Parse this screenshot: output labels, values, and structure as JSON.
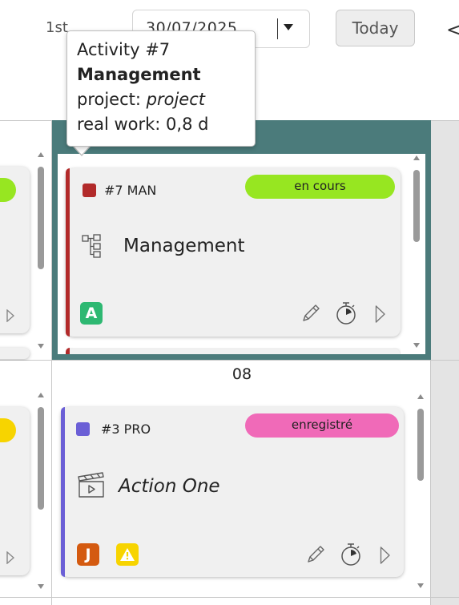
{
  "toolbar": {
    "prefix_label": "1st",
    "date_value": "30/07/2025",
    "today_label": "Today",
    "prev_icon": "chevron-left-icon"
  },
  "calendar": {
    "today_day_label": "",
    "next_day_label": "08",
    "today_header_color": "#4b7b7b"
  },
  "cards": [
    {
      "ref": "#7 MAN",
      "type_color": "#b22a2a",
      "status": "en cours",
      "status_color": "#97e621",
      "type_icon": "hierarchy-icon",
      "title": "Management",
      "title_italic": false,
      "avatars": [
        {
          "label": "A",
          "color": "#2eb872",
          "icon": null
        }
      ],
      "actions": [
        "edit-pencil-icon",
        "stopwatch-icon",
        "play-icon"
      ]
    },
    {
      "ref": "#3 PRO",
      "type_color": "#6b5fd6",
      "status": "enregistré",
      "status_color": "#f06ab8",
      "type_icon": "clapperboard-icon",
      "title": "Action One",
      "title_italic": true,
      "avatars": [
        {
          "label": "J",
          "color": "#d45a10",
          "icon": null
        },
        {
          "label": "!",
          "color": "#f7d400",
          "icon": "warning-icon"
        }
      ],
      "actions": [
        "edit-pencil-icon",
        "stopwatch-icon",
        "play-icon"
      ]
    }
  ],
  "left_cards": [
    {
      "pill_color": "#97e621"
    },
    {
      "pill_color": "#f7d400"
    }
  ],
  "tooltip": {
    "line1": "Activity #7",
    "line2": "Management",
    "line3_label": "project: ",
    "line3_value": "project",
    "line4": "real work: 0,8 d"
  }
}
